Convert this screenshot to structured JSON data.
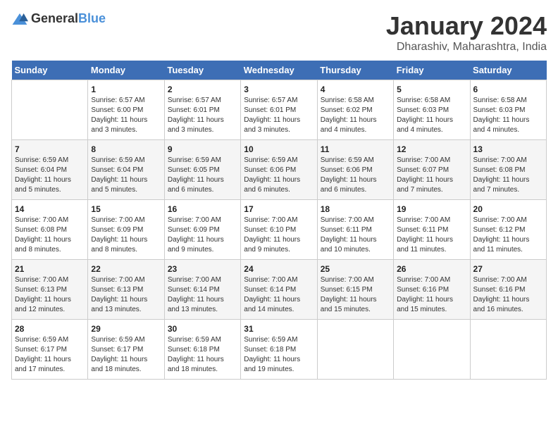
{
  "header": {
    "logo_general": "General",
    "logo_blue": "Blue",
    "title": "January 2024",
    "subtitle": "Dharashiv, Maharashtra, India"
  },
  "calendar": {
    "days_of_week": [
      "Sunday",
      "Monday",
      "Tuesday",
      "Wednesday",
      "Thursday",
      "Friday",
      "Saturday"
    ],
    "weeks": [
      [
        {
          "day": "",
          "info": ""
        },
        {
          "day": "1",
          "info": "Sunrise: 6:57 AM\nSunset: 6:00 PM\nDaylight: 11 hours\nand 3 minutes."
        },
        {
          "day": "2",
          "info": "Sunrise: 6:57 AM\nSunset: 6:01 PM\nDaylight: 11 hours\nand 3 minutes."
        },
        {
          "day": "3",
          "info": "Sunrise: 6:57 AM\nSunset: 6:01 PM\nDaylight: 11 hours\nand 3 minutes."
        },
        {
          "day": "4",
          "info": "Sunrise: 6:58 AM\nSunset: 6:02 PM\nDaylight: 11 hours\nand 4 minutes."
        },
        {
          "day": "5",
          "info": "Sunrise: 6:58 AM\nSunset: 6:03 PM\nDaylight: 11 hours\nand 4 minutes."
        },
        {
          "day": "6",
          "info": "Sunrise: 6:58 AM\nSunset: 6:03 PM\nDaylight: 11 hours\nand 4 minutes."
        }
      ],
      [
        {
          "day": "7",
          "info": "Sunrise: 6:59 AM\nSunset: 6:04 PM\nDaylight: 11 hours\nand 5 minutes."
        },
        {
          "day": "8",
          "info": "Sunrise: 6:59 AM\nSunset: 6:04 PM\nDaylight: 11 hours\nand 5 minutes."
        },
        {
          "day": "9",
          "info": "Sunrise: 6:59 AM\nSunset: 6:05 PM\nDaylight: 11 hours\nand 6 minutes."
        },
        {
          "day": "10",
          "info": "Sunrise: 6:59 AM\nSunset: 6:06 PM\nDaylight: 11 hours\nand 6 minutes."
        },
        {
          "day": "11",
          "info": "Sunrise: 6:59 AM\nSunset: 6:06 PM\nDaylight: 11 hours\nand 6 minutes."
        },
        {
          "day": "12",
          "info": "Sunrise: 7:00 AM\nSunset: 6:07 PM\nDaylight: 11 hours\nand 7 minutes."
        },
        {
          "day": "13",
          "info": "Sunrise: 7:00 AM\nSunset: 6:08 PM\nDaylight: 11 hours\nand 7 minutes."
        }
      ],
      [
        {
          "day": "14",
          "info": "Sunrise: 7:00 AM\nSunset: 6:08 PM\nDaylight: 11 hours\nand 8 minutes."
        },
        {
          "day": "15",
          "info": "Sunrise: 7:00 AM\nSunset: 6:09 PM\nDaylight: 11 hours\nand 8 minutes."
        },
        {
          "day": "16",
          "info": "Sunrise: 7:00 AM\nSunset: 6:09 PM\nDaylight: 11 hours\nand 9 minutes."
        },
        {
          "day": "17",
          "info": "Sunrise: 7:00 AM\nSunset: 6:10 PM\nDaylight: 11 hours\nand 9 minutes."
        },
        {
          "day": "18",
          "info": "Sunrise: 7:00 AM\nSunset: 6:11 PM\nDaylight: 11 hours\nand 10 minutes."
        },
        {
          "day": "19",
          "info": "Sunrise: 7:00 AM\nSunset: 6:11 PM\nDaylight: 11 hours\nand 11 minutes."
        },
        {
          "day": "20",
          "info": "Sunrise: 7:00 AM\nSunset: 6:12 PM\nDaylight: 11 hours\nand 11 minutes."
        }
      ],
      [
        {
          "day": "21",
          "info": "Sunrise: 7:00 AM\nSunset: 6:13 PM\nDaylight: 11 hours\nand 12 minutes."
        },
        {
          "day": "22",
          "info": "Sunrise: 7:00 AM\nSunset: 6:13 PM\nDaylight: 11 hours\nand 13 minutes."
        },
        {
          "day": "23",
          "info": "Sunrise: 7:00 AM\nSunset: 6:14 PM\nDaylight: 11 hours\nand 13 minutes."
        },
        {
          "day": "24",
          "info": "Sunrise: 7:00 AM\nSunset: 6:14 PM\nDaylight: 11 hours\nand 14 minutes."
        },
        {
          "day": "25",
          "info": "Sunrise: 7:00 AM\nSunset: 6:15 PM\nDaylight: 11 hours\nand 15 minutes."
        },
        {
          "day": "26",
          "info": "Sunrise: 7:00 AM\nSunset: 6:16 PM\nDaylight: 11 hours\nand 15 minutes."
        },
        {
          "day": "27",
          "info": "Sunrise: 7:00 AM\nSunset: 6:16 PM\nDaylight: 11 hours\nand 16 minutes."
        }
      ],
      [
        {
          "day": "28",
          "info": "Sunrise: 6:59 AM\nSunset: 6:17 PM\nDaylight: 11 hours\nand 17 minutes."
        },
        {
          "day": "29",
          "info": "Sunrise: 6:59 AM\nSunset: 6:17 PM\nDaylight: 11 hours\nand 18 minutes."
        },
        {
          "day": "30",
          "info": "Sunrise: 6:59 AM\nSunset: 6:18 PM\nDaylight: 11 hours\nand 18 minutes."
        },
        {
          "day": "31",
          "info": "Sunrise: 6:59 AM\nSunset: 6:18 PM\nDaylight: 11 hours\nand 19 minutes."
        },
        {
          "day": "",
          "info": ""
        },
        {
          "day": "",
          "info": ""
        },
        {
          "day": "",
          "info": ""
        }
      ]
    ]
  }
}
